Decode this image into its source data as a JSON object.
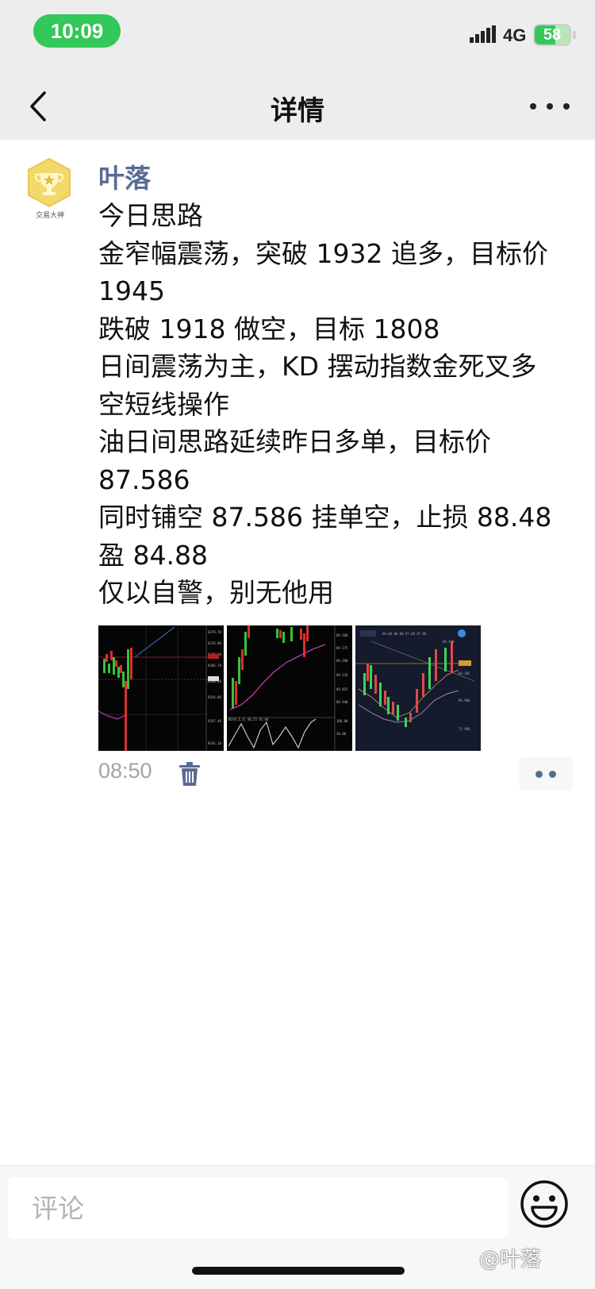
{
  "status_bar": {
    "time": "10:09",
    "network": "4G",
    "battery": "58",
    "battery_level": 0.58
  },
  "nav": {
    "title": "详情",
    "back_icon": "chevron-left-icon",
    "more_icon": "more-dots-icon"
  },
  "post": {
    "author": "叶落",
    "avatar_caption": "交易大神",
    "lines": [
      "今日思路",
      "金窄幅震荡，突破 1932 追多，目标价",
      "1945",
      "跌破 1918 做空，目标 1808",
      "日间震荡为主，KD 摆动指数金死叉多",
      "空短线操作",
      "油日间思路延续昨日多单，目标价",
      "87.586",
      "同时铺空 87.586 挂单空，止损 88.48",
      "盈 84.88",
      "仅以自警，别无他用"
    ],
    "time": "08:50",
    "images": [
      "chart-thumbnail-1",
      "chart-thumbnail-2",
      "chart-thumbnail-3"
    ]
  },
  "comment": {
    "placeholder": "评论"
  },
  "watermark": "@叶落",
  "colors": {
    "accent_name": "#576b95",
    "status_green": "#34c759",
    "bar_bg": "#ededed"
  }
}
